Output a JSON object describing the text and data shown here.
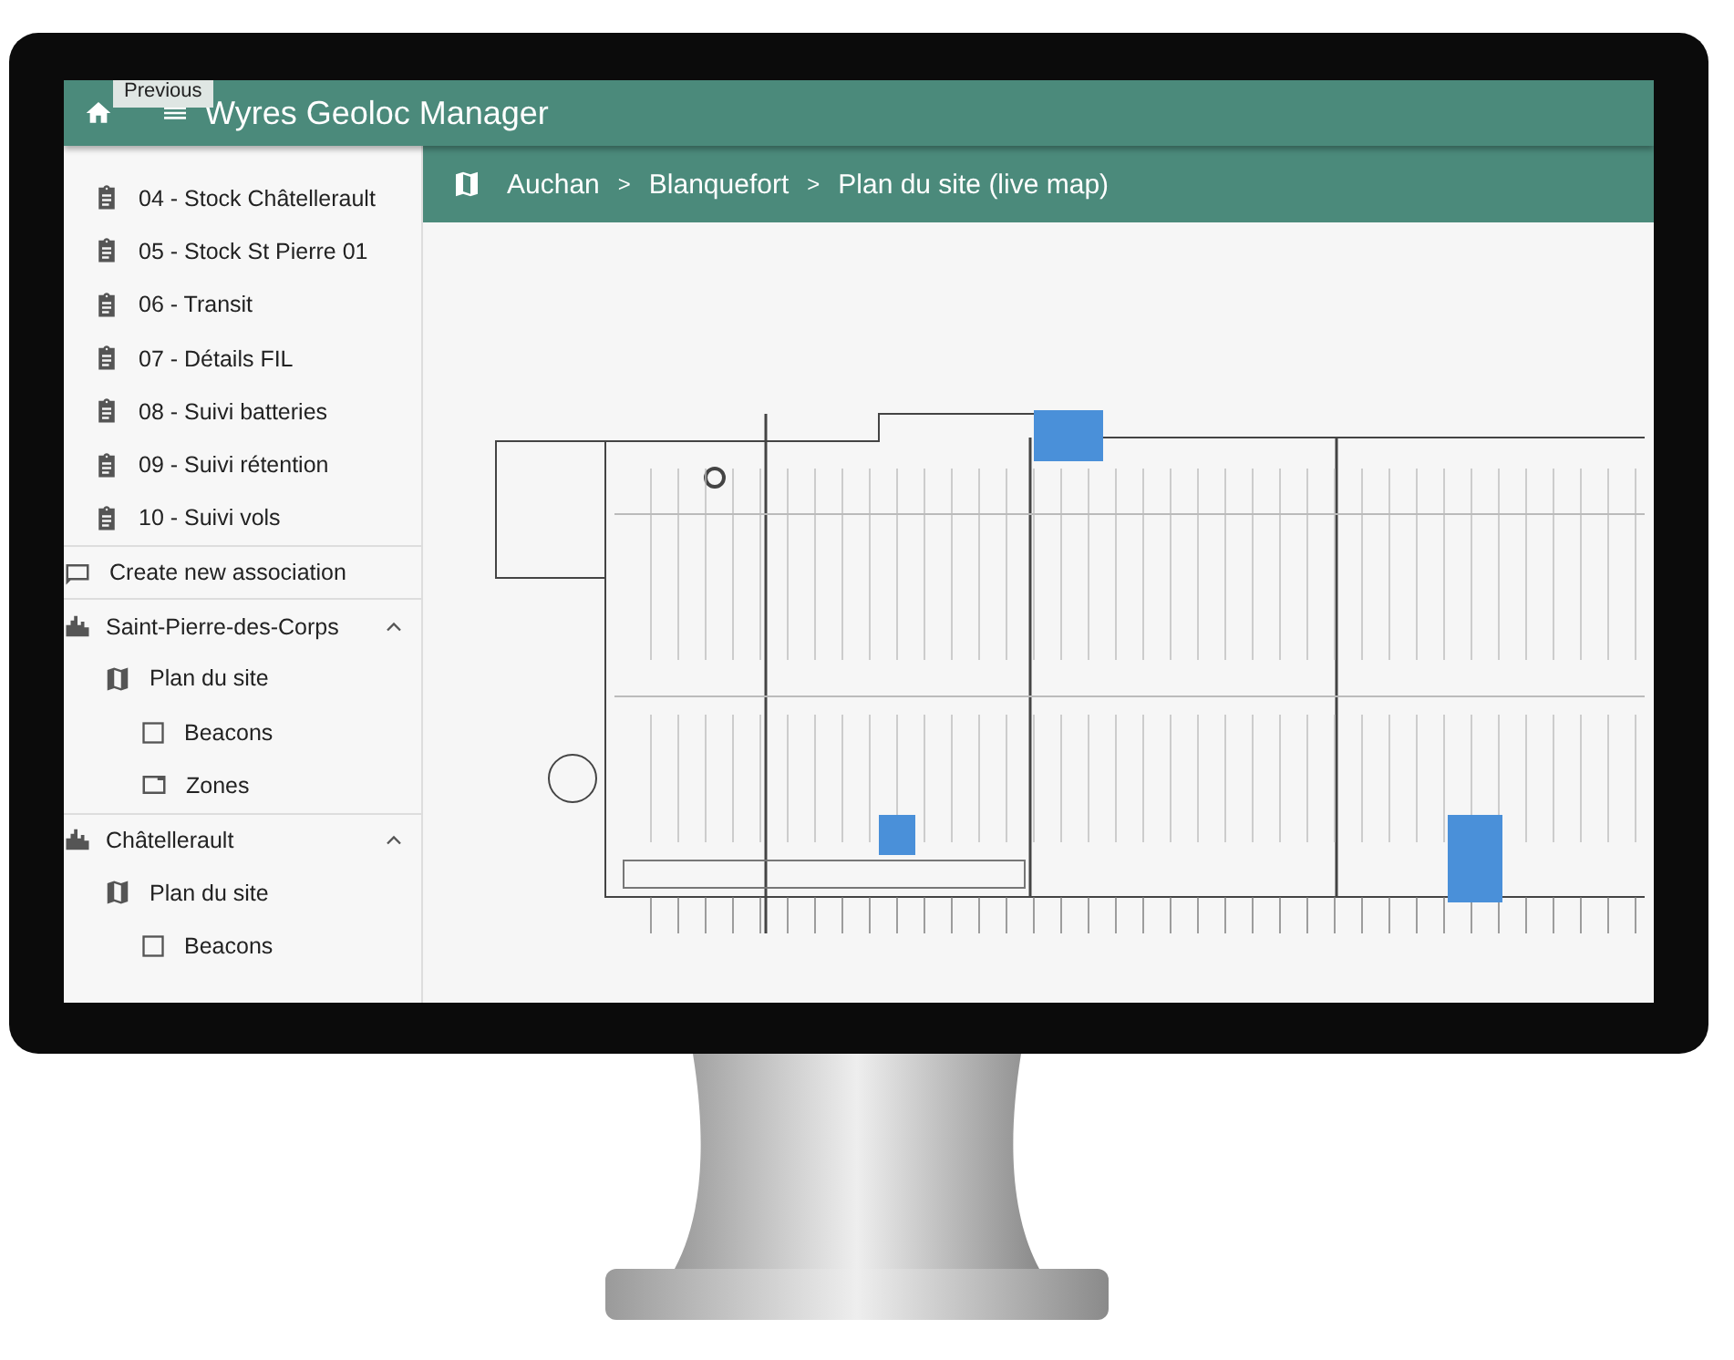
{
  "app_bar": {
    "title": "Wyres Geoloc Manager",
    "tooltip": "Previous"
  },
  "sidebar": {
    "items": [
      {
        "kind": "report",
        "label": "04 - Stock Châtellerault"
      },
      {
        "kind": "report",
        "label": "05 - Stock St Pierre 01"
      },
      {
        "kind": "report",
        "label": "06 - Transit"
      },
      {
        "kind": "report",
        "label": "07 - Détails FIL"
      },
      {
        "kind": "report",
        "label": "08 - Suivi batteries"
      },
      {
        "kind": "report",
        "label": "09 - Suivi rétention"
      },
      {
        "kind": "report",
        "label": "10 - Suivi vols"
      },
      {
        "kind": "action",
        "label": "Create new association"
      },
      {
        "kind": "site",
        "label": "Saint-Pierre-des-Corps",
        "expanded": true,
        "children": [
          {
            "kind": "map",
            "label": "Plan du site",
            "children": [
              {
                "kind": "beacons",
                "label": "Beacons"
              },
              {
                "kind": "zones",
                "label": "Zones"
              }
            ]
          }
        ]
      },
      {
        "kind": "site",
        "label": "Châtellerault",
        "expanded": true,
        "children": [
          {
            "kind": "map",
            "label": "Plan du site",
            "children": [
              {
                "kind": "beacons",
                "label": "Beacons"
              }
            ]
          }
        ]
      }
    ]
  },
  "breadcrumb": {
    "items": [
      "Auchan",
      "Blanquefort",
      "Plan du site (live map)"
    ],
    "separator": ">"
  }
}
